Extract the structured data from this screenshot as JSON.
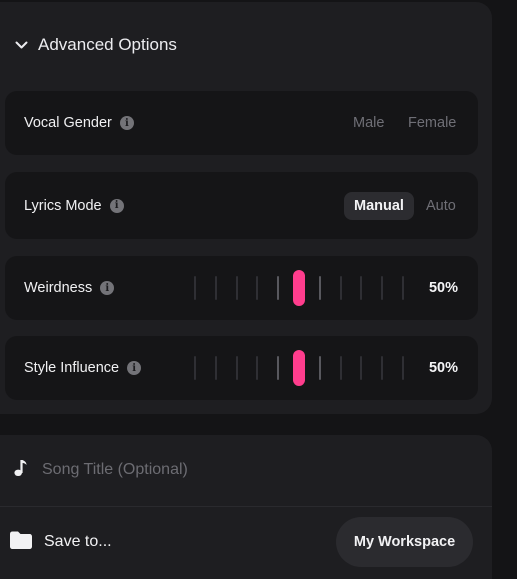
{
  "advanced": {
    "title": "Advanced Options",
    "expanded": true,
    "vocal_gender": {
      "label": "Vocal Gender",
      "options": [
        "Male",
        "Female"
      ],
      "selected": null
    },
    "lyrics_mode": {
      "label": "Lyrics Mode",
      "options": [
        "Manual",
        "Auto"
      ],
      "selected": "Manual"
    },
    "weirdness": {
      "label": "Weirdness",
      "value": 0.5,
      "value_label": "50%"
    },
    "style_influence": {
      "label": "Style Influence",
      "value": 0.5,
      "value_label": "50%"
    }
  },
  "song_title": {
    "placeholder": "Song Title (Optional)",
    "value": ""
  },
  "save": {
    "label": "Save to...",
    "workspace_button": "My Workspace"
  },
  "colors": {
    "accent": "#ff3d8d",
    "background": "#141416",
    "panel": "#1e1e21",
    "row": "#151517"
  },
  "icons": {
    "collapse": "chevron-down-icon",
    "info": "info-icon",
    "song": "music-note-icon",
    "folder": "folder-icon"
  }
}
